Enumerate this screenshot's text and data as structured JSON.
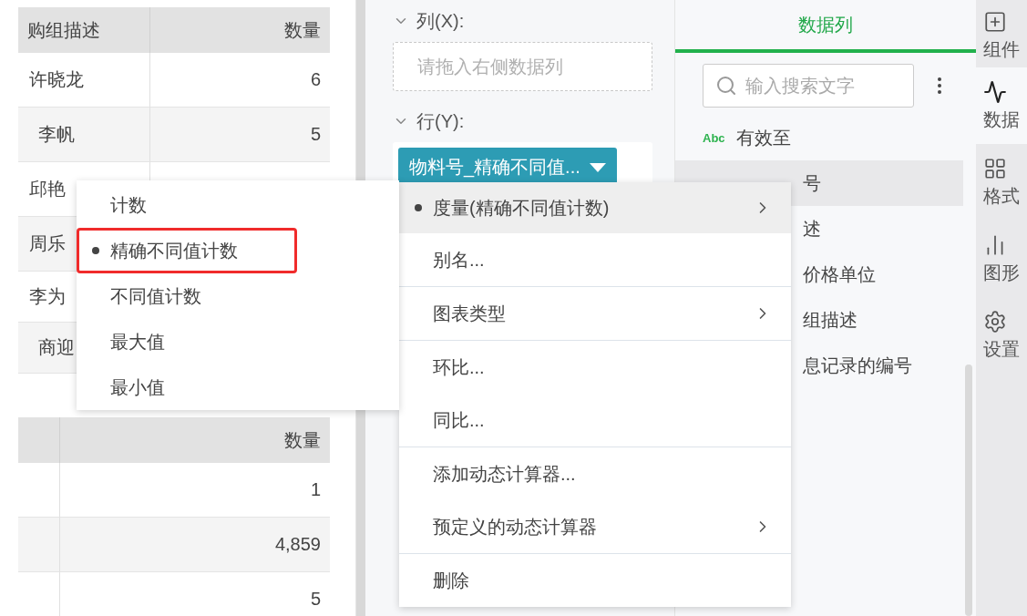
{
  "table_top": {
    "columns": [
      "购组描述",
      "数量"
    ],
    "rows": [
      {
        "name": "许晓龙",
        "count": "6",
        "indented": false
      },
      {
        "name": "李帆",
        "count": "5",
        "indented": true
      },
      {
        "name": "邱艳",
        "indented": false
      },
      {
        "name": "周乐",
        "indented": false
      },
      {
        "name": "李为",
        "indented": false
      },
      {
        "name": "商迎",
        "indented": true
      }
    ]
  },
  "table_bottom": {
    "columns": [
      "数量"
    ],
    "rows": [
      "1",
      "4,859",
      "5"
    ]
  },
  "fields": {
    "column_label": "列(X):",
    "column_placeholder": "请拖入右侧数据列",
    "row_label": "行(Y):",
    "row_pill": "物料号_精确不同值..."
  },
  "context_menu": [
    [
      {
        "label": "度量(精确不同值计数)",
        "checked": true,
        "selected": true,
        "has_submenu": true
      },
      {
        "label": "别名...",
        "checked": false,
        "selected": false,
        "has_submenu": false
      }
    ],
    [
      {
        "label": "图表类型",
        "checked": false,
        "selected": false,
        "has_submenu": true
      }
    ],
    [
      {
        "label": "环比...",
        "checked": false,
        "selected": false,
        "has_submenu": false
      },
      {
        "label": "同比...",
        "checked": false,
        "selected": false,
        "has_submenu": false
      }
    ],
    [
      {
        "label": "添加动态计算器...",
        "checked": false,
        "selected": false,
        "has_submenu": false
      },
      {
        "label": "预定义的动态计算器",
        "checked": false,
        "selected": false,
        "has_submenu": true
      }
    ],
    [
      {
        "label": "删除",
        "checked": false,
        "selected": false,
        "has_submenu": false
      }
    ]
  ],
  "aggregation_menu": [
    {
      "label": "计数",
      "selected": false,
      "annotated": false
    },
    {
      "label": "精确不同值计数",
      "selected": true,
      "annotated": true
    },
    {
      "label": "不同值计数",
      "selected": false,
      "annotated": false
    },
    {
      "label": "最大值",
      "selected": false,
      "annotated": false
    },
    {
      "label": "最小值",
      "selected": false,
      "annotated": false
    }
  ],
  "data_panel": {
    "tab": "数据列",
    "search_placeholder": "输入搜索文字",
    "items": [
      {
        "kind": "full",
        "type_badge": "Abc",
        "label": "有效至",
        "selected": false
      },
      {
        "kind": "partial",
        "label": "号",
        "selected": true
      },
      {
        "kind": "partial",
        "label": "述",
        "selected": false
      },
      {
        "kind": "partial",
        "label": "价格单位",
        "selected": false
      },
      {
        "kind": "partial",
        "label": "组描述",
        "selected": false
      },
      {
        "kind": "partial",
        "label": "息记录的编号",
        "selected": false
      }
    ]
  },
  "side_tabs": [
    {
      "kind": "widget",
      "label": "组件",
      "selected": false
    },
    {
      "kind": "data",
      "label": "数据",
      "selected": true
    },
    {
      "kind": "format",
      "label": "格式",
      "selected": false
    },
    {
      "kind": "graph",
      "label": "图形",
      "selected": false
    },
    {
      "kind": "settings",
      "label": "设置",
      "selected": false
    }
  ]
}
